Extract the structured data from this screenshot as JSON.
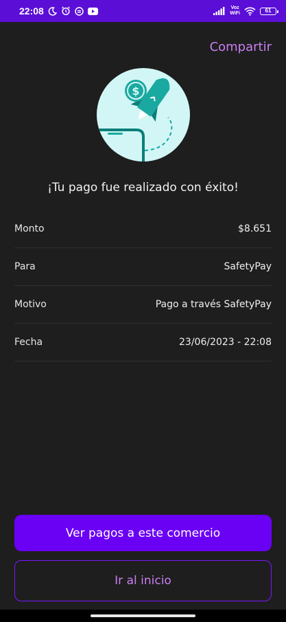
{
  "status_bar": {
    "time": "22:08",
    "network_label_top": "Voz",
    "network_label_bottom": "WiFi",
    "battery": "61"
  },
  "header": {
    "share_label": "Compartir"
  },
  "success": {
    "title": "¡Tu pago fue realizado con éxito!"
  },
  "details": [
    {
      "label": "Monto",
      "value": "$8.651"
    },
    {
      "label": "Para",
      "value": "SafetyPay"
    },
    {
      "label": "Motivo",
      "value": "Pago a través SafetyPay"
    },
    {
      "label": "Fecha",
      "value": "23/06/2023 - 22:08"
    }
  ],
  "actions": {
    "primary_label": "Ver pagos a este comercio",
    "secondary_label": "Ir al inicio"
  },
  "colors": {
    "status_bar": "#5b0fd6",
    "background": "#1e1e1e",
    "accent_text": "#c97ff2",
    "primary_button": "#6a00f4",
    "illustration_circle": "#d2f6f6",
    "illustration_teal": "#1aa9a0"
  },
  "icons": {
    "status": [
      "moon-icon",
      "alarm-icon",
      "app-icon",
      "youtube-icon",
      "signal-icon",
      "wifi-icon",
      "battery-icon"
    ],
    "illustration": "rocket-coin-illustration"
  }
}
